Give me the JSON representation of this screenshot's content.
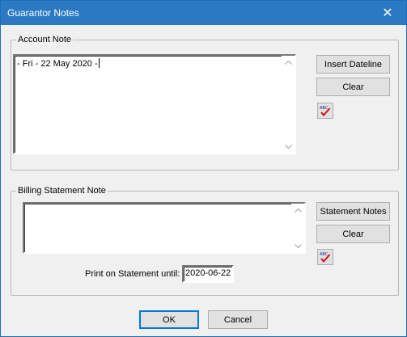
{
  "window": {
    "title": "Guarantor Notes",
    "close_glyph": "✕"
  },
  "account_note": {
    "group_label": "Account Note",
    "text": "- Fri - 22 May 2020 -",
    "insert_dateline_label": "Insert Dateline",
    "clear_label": "Clear",
    "spellcheck_icon": "spellcheck-icon"
  },
  "billing_note": {
    "group_label": "Billing Statement Note",
    "text": "",
    "statement_notes_label": "Statement Notes",
    "clear_label": "Clear",
    "spellcheck_icon": "spellcheck-icon",
    "print_until_label": "Print on Statement until:",
    "print_until_value": "2020-06-22"
  },
  "footer": {
    "ok_label": "OK",
    "cancel_label": "Cancel"
  },
  "colors": {
    "titlebar": "#2b79c2",
    "spell_check_mark": "#d01010"
  }
}
